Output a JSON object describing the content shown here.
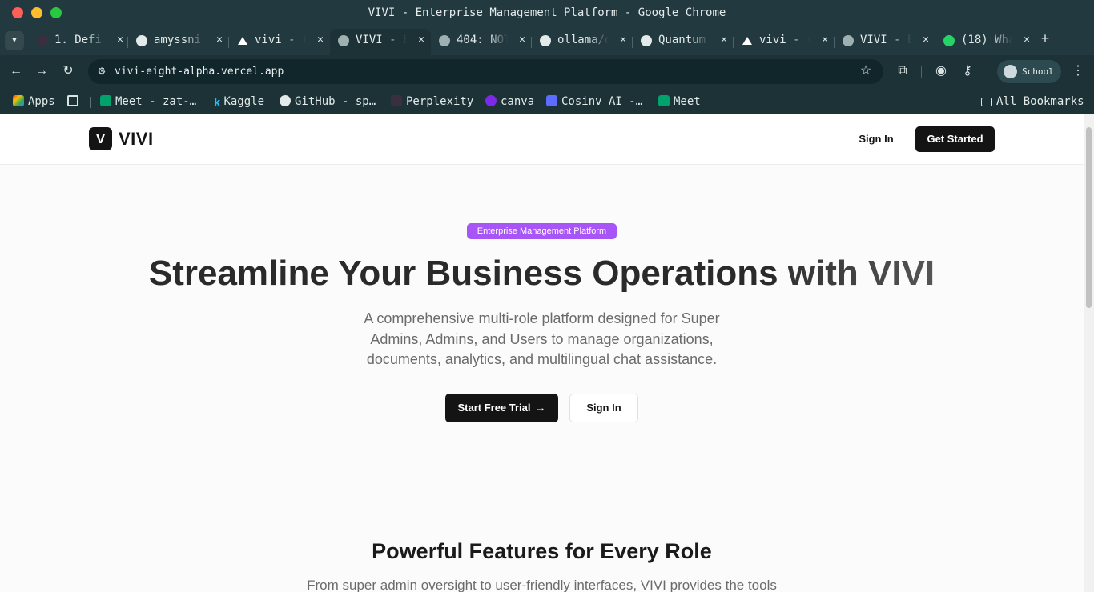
{
  "window": {
    "title": "VIVI - Enterprise Management Platform - Google Chrome"
  },
  "tabs": [
    {
      "label": "1. Defi",
      "icon": "perplexity-icon",
      "active": false
    },
    {
      "label": "amyssni",
      "icon": "github-icon",
      "active": false
    },
    {
      "label": "vivi - (",
      "icon": "vercel-icon",
      "active": false
    },
    {
      "label": "VIVI - E",
      "icon": "globe-icon",
      "active": true
    },
    {
      "label": "404: NOT",
      "icon": "globe-icon",
      "active": false
    },
    {
      "label": "ollama/o",
      "icon": "github-icon",
      "active": false
    },
    {
      "label": "Quantum",
      "icon": "github-icon",
      "active": false
    },
    {
      "label": "vivi - (",
      "icon": "vercel-icon",
      "active": false
    },
    {
      "label": "VIVI - E",
      "icon": "globe-icon",
      "active": false
    },
    {
      "label": "(18) Wha",
      "icon": "whatsapp-icon",
      "active": false
    }
  ],
  "tab_close_glyph": "✕",
  "new_tab_glyph": "+",
  "toolbar": {
    "url": "vivi-eight-alpha.vercel.app",
    "profile_label": "School"
  },
  "bookmarks": {
    "apps": "Apps",
    "items": [
      "Meet - zat-…",
      "Kaggle",
      "GitHub - sp…",
      "Perplexity",
      "canva",
      "Cosinv AI -…",
      "Meet"
    ],
    "all_bookmarks": "All Bookmarks"
  },
  "site": {
    "logo_letter": "V",
    "brand": "VIVI",
    "nav_signin": "Sign In",
    "nav_cta": "Get Started"
  },
  "hero": {
    "badge": "Enterprise Management Platform",
    "title_main": "Streamline Your Business Operations ",
    "title_accent": "with VIVI",
    "subtitle": "A comprehensive multi-role platform designed for Super Admins, Admins, and Users to manage organizations, documents, analytics, and multilingual chat assistance.",
    "primary_cta": "Start Free Trial",
    "secondary_cta": "Sign In"
  },
  "features": {
    "title": "Powerful Features for Every Role",
    "subtitle": "From super admin oversight to user-friendly interfaces, VIVI provides the tools"
  },
  "colors": {
    "chrome_bg": "#223a3f",
    "badge_purple": "#a855f7",
    "primary_dark": "#141414"
  }
}
